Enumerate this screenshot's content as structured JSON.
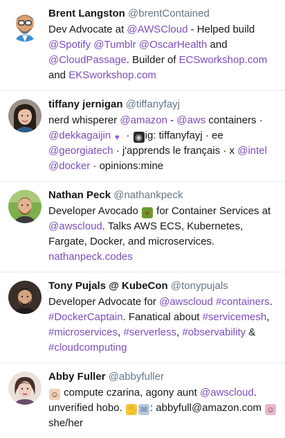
{
  "profiles": [
    {
      "name": "Brent Langston",
      "handle": "@brentContained",
      "bio": [
        {
          "t": "Dev Advocate at "
        },
        {
          "t": "@AWSCloud",
          "link": true
        },
        {
          "t": " - Helped build "
        },
        {
          "t": "@Spotify",
          "link": true
        },
        {
          "t": " "
        },
        {
          "t": "@Tumblr",
          "link": true
        },
        {
          "t": " "
        },
        {
          "t": "@OscarHealth",
          "link": true
        },
        {
          "t": " and "
        },
        {
          "t": "@CloudPassage",
          "link": true
        },
        {
          "t": ". Builder of "
        },
        {
          "t": "ECSworkshop.com",
          "link": true
        },
        {
          "t": " and "
        },
        {
          "t": "EKSworkshop.com",
          "link": true
        }
      ]
    },
    {
      "name": "tiffany jernigan",
      "handle": "@tiffanyfayj",
      "bio": [
        {
          "t": "nerd whisperer "
        },
        {
          "t": "@amazon",
          "link": true
        },
        {
          "t": " - "
        },
        {
          "t": "@aws",
          "link": true
        },
        {
          "t": " containers · "
        },
        {
          "t": "@dekkagaijin",
          "link": true
        },
        {
          "emoji": "purple-heart-emoji"
        },
        {
          "t": " · "
        },
        {
          "emoji": "camera-emoji"
        },
        {
          "t": "ig: tiffanyfayj · ee "
        },
        {
          "t": "@georgiatech",
          "link": true
        },
        {
          "t": " · j'apprends le français · x "
        },
        {
          "t": "@intel",
          "link": true
        },
        {
          "t": " "
        },
        {
          "t": "@docker",
          "link": true
        },
        {
          "t": " · opinions:mine"
        }
      ]
    },
    {
      "name": "Nathan Peck",
      "handle": "@nathankpeck",
      "bio": [
        {
          "t": "Developer Avocado "
        },
        {
          "emoji": "avocado-emoji"
        },
        {
          "t": " for Container Services at "
        },
        {
          "t": "@awscloud",
          "link": true
        },
        {
          "t": ". Talks AWS ECS, Kubernetes, Fargate, Docker, and microservices. "
        },
        {
          "t": "nathanpeck.codes",
          "link": true
        }
      ]
    },
    {
      "name": "Tony Pujals @ KubeCon",
      "handle": "@tonypujals",
      "bio": [
        {
          "t": "Developer Advocate for "
        },
        {
          "t": "@awscloud",
          "link": true
        },
        {
          "t": " "
        },
        {
          "t": "#containers",
          "link": true
        },
        {
          "t": ". "
        },
        {
          "t": "#DockerCaptain",
          "link": true
        },
        {
          "t": ". Fanatical about "
        },
        {
          "t": "#servicemesh",
          "link": true
        },
        {
          "t": ", "
        },
        {
          "t": "#microservices",
          "link": true
        },
        {
          "t": ", "
        },
        {
          "t": "#serverless",
          "link": true
        },
        {
          "t": ", "
        },
        {
          "t": "#observability",
          "link": true
        },
        {
          "t": " & "
        },
        {
          "t": "#cloudcomputing",
          "link": true
        }
      ]
    },
    {
      "name": "Abby Fuller",
      "handle": "@abbyfuller",
      "bio": [
        {
          "emoji": "woman-tipping-hand-emoji"
        },
        {
          "t": " compute czarina, agony aunt "
        },
        {
          "t": "@awscloud",
          "link": true
        },
        {
          "t": ". unverified hobo. "
        },
        {
          "emoji": "clapping-hands-emoji"
        },
        {
          "emoji": "envelope-arrow-emoji"
        },
        {
          "t": ": abbyfull@amazon.com "
        },
        {
          "emoji": "woman-raising-hand-emoji"
        },
        {
          "t": " she/her"
        }
      ]
    }
  ],
  "colors": {
    "link": "#7c4dbd",
    "name": "#14171a",
    "handle": "#657786",
    "divider": "#e6ecf0"
  }
}
